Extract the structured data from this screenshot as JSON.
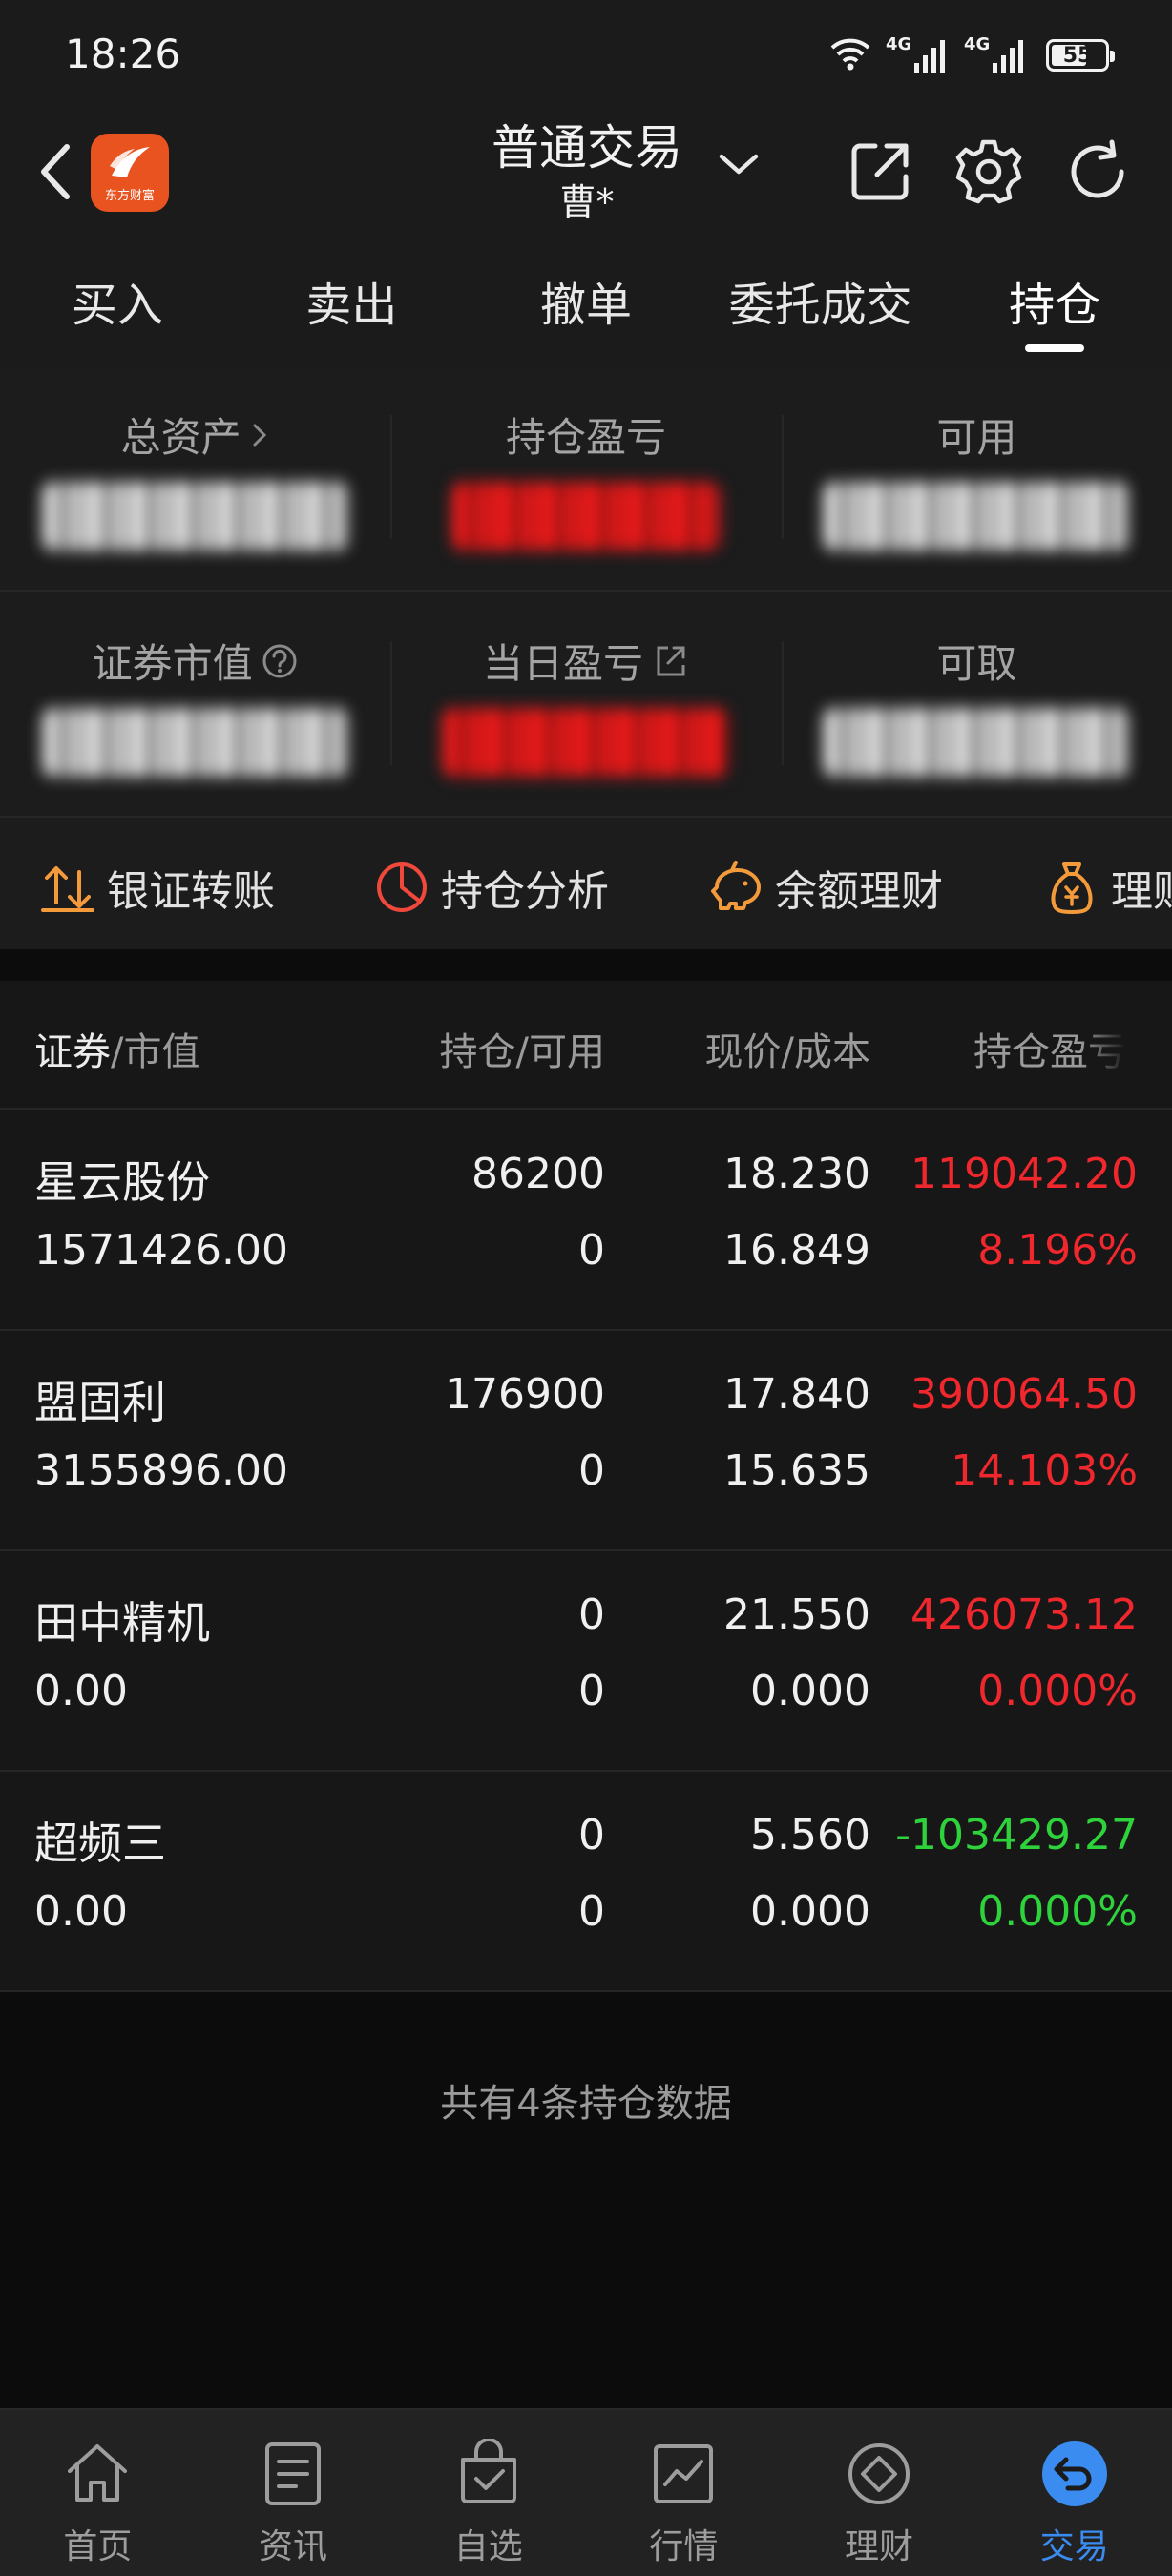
{
  "status_bar": {
    "time": "18:26",
    "net1": "4G",
    "net2": "4G",
    "battery": "55"
  },
  "header": {
    "title": "普通交易",
    "subtitle": "曹*",
    "logo_text": "东方财富"
  },
  "tabs": [
    {
      "label": "买入"
    },
    {
      "label": "卖出"
    },
    {
      "label": "撤单"
    },
    {
      "label": "委托成交"
    },
    {
      "label": "持仓",
      "active": true
    }
  ],
  "summary": {
    "total_assets": "总资产",
    "position_pl": "持仓盈亏",
    "available": "可用",
    "market_value": "证券市值",
    "daily_pl": "当日盈亏",
    "withdrawable": "可取"
  },
  "quick_actions": [
    {
      "label": "银证转账",
      "icon": "transfer-icon"
    },
    {
      "label": "持仓分析",
      "icon": "pie-chart-icon"
    },
    {
      "label": "余额理财",
      "icon": "piggy-bank-icon"
    },
    {
      "label": "理财",
      "icon": "money-bag-icon"
    }
  ],
  "table": {
    "headers": {
      "security": "证券",
      "market_value": "/市值",
      "holding": "持仓/可用",
      "price": "现价/成本",
      "pl": "持仓盈亏"
    },
    "rows": [
      {
        "name": "星云股份",
        "market_value": "1571426.00",
        "holding": "86200",
        "available": "0",
        "price": "18.230",
        "cost": "16.849",
        "pl": "119042.20",
        "pct": "8.196%",
        "trend": "red"
      },
      {
        "name": "盟固利",
        "market_value": "3155896.00",
        "holding": "176900",
        "available": "0",
        "price": "17.840",
        "cost": "15.635",
        "pl": "390064.50",
        "pct": "14.103%",
        "trend": "red"
      },
      {
        "name": "田中精机",
        "market_value": "0.00",
        "holding": "0",
        "available": "0",
        "price": "21.550",
        "cost": "0.000",
        "pl": "426073.12",
        "pct": "0.000%",
        "trend": "red"
      },
      {
        "name": "超频三",
        "market_value": "0.00",
        "holding": "0",
        "available": "0",
        "price": "5.560",
        "cost": "0.000",
        "pl": "-103429.27",
        "pct": "0.000%",
        "trend": "green"
      }
    ]
  },
  "footer_note": "共有4条持仓数据",
  "bottom_nav": [
    {
      "label": "首页",
      "icon": "home-icon"
    },
    {
      "label": "资讯",
      "icon": "news-icon"
    },
    {
      "label": "自选",
      "icon": "watchlist-icon"
    },
    {
      "label": "行情",
      "icon": "market-icon"
    },
    {
      "label": "理财",
      "icon": "wealth-icon"
    },
    {
      "label": "交易",
      "icon": "trade-icon",
      "active": true
    }
  ],
  "colors": {
    "up": "#f0282d",
    "down": "#2ed33c",
    "accent": "#3b8cf0",
    "orange": "#f39a3b"
  }
}
